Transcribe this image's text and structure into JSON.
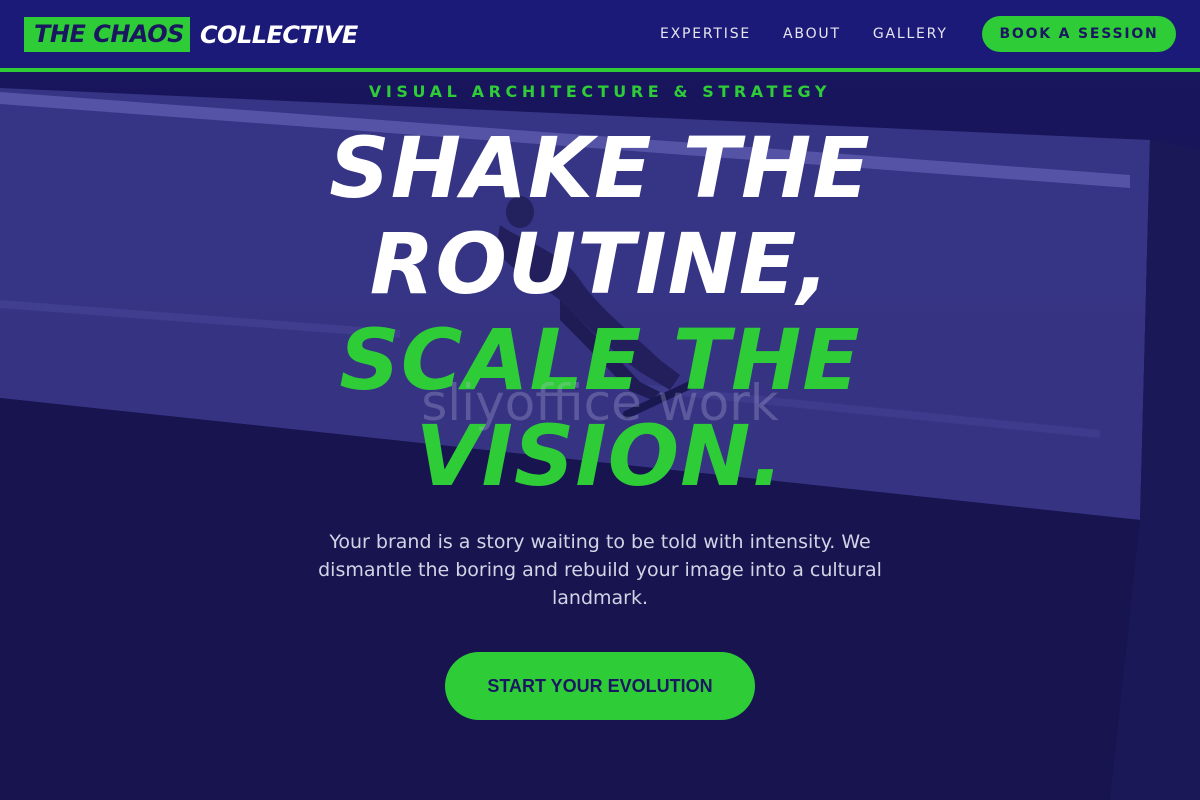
{
  "brand": {
    "logo_highlight": "THE CHAOS",
    "logo_rest": "COLLECTIVE"
  },
  "nav": {
    "links": [
      "EXPERTISE",
      "ABOUT",
      "GALLERY"
    ],
    "cta_label": "BOOK A SESSION"
  },
  "hero": {
    "eyebrow": "VISUAL ARCHITECTURE & STRATEGY",
    "headline_line1": "SHAKE THE",
    "headline_line2": "ROUTINE,",
    "headline_line3": "SCALE THE",
    "headline_line4": "VISION.",
    "watermark": "sliyoffice work",
    "subtext": "Your brand is a story waiting to be told with intensity. We dismantle the boring and rebuild your image into a cultural landmark.",
    "cta_label": "START YOUR EVOLUTION"
  },
  "colors": {
    "accent": "#2ecc37",
    "navy": "#1c1a78",
    "background": "#15124f",
    "text_light": "#d3d3e6"
  }
}
